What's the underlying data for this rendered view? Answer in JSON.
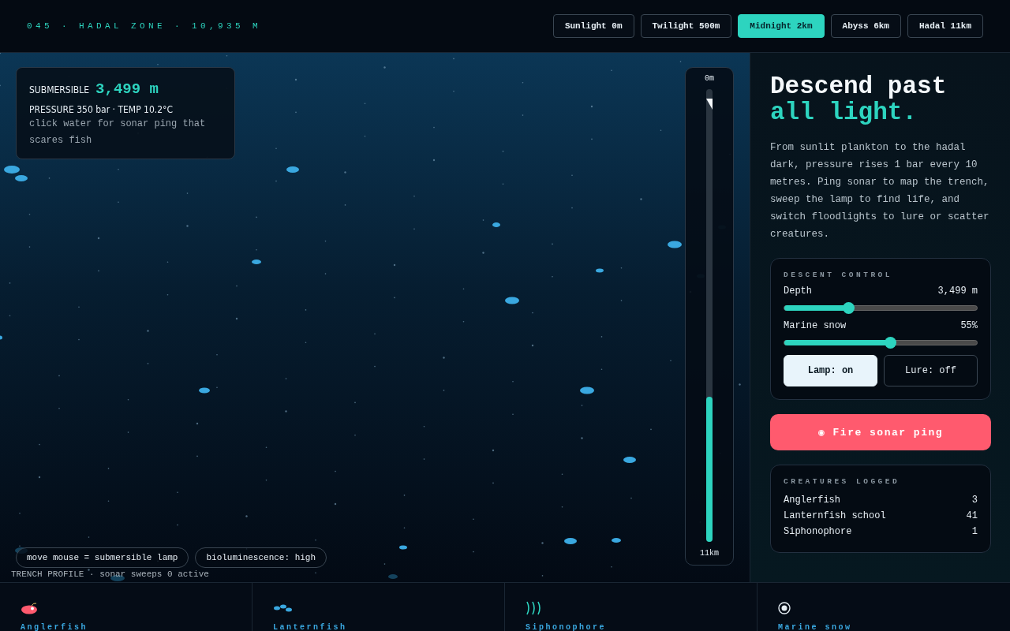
{
  "header": {
    "title": "045 · HADAL ZONE · 10,935 M"
  },
  "zones": [
    {
      "label": "Sunlight 0m",
      "selected": false
    },
    {
      "label": "Twilight 500m",
      "selected": false
    },
    {
      "label": "Midnight 2km",
      "selected": true
    },
    {
      "label": "Abyss 6km",
      "selected": false
    },
    {
      "label": "Hadal 11km",
      "selected": false
    }
  ],
  "hud": {
    "label": "SUBMERSIBLE",
    "depth": "3,499 m",
    "readings": "PRESSURE 350 bar · TEMP 10.2°C",
    "hint": "click water for sonar ping that scares fish"
  },
  "gauge": {
    "top": "0m",
    "bottom": "11km",
    "level": 0.32
  },
  "chips": [
    "move mouse = submersible lamp",
    "bioluminescence: high"
  ],
  "profile": "TRENCH PROFILE · sonar sweeps 0 active",
  "intro": {
    "title": "Descend past",
    "accent": "all light.",
    "body": "From sunlit plankton to the hadal dark, pressure rises 1 bar every 10 metres. Ping sonar to map the trench, sweep the lamp to find life, and switch floodlights to lure or scatter creatures."
  },
  "control": {
    "heading": "DESCENT CONTROL",
    "sliders": [
      {
        "label": "Depth",
        "reading": "3,499 m",
        "level": 0.33
      },
      {
        "label": "Marine snow",
        "reading": "55%",
        "level": 0.55
      }
    ],
    "toggles": [
      {
        "label": "Lamp: on",
        "on": true
      },
      {
        "label": "Lure: off",
        "on": false
      }
    ]
  },
  "ping_button": "◉ Fire sonar ping",
  "log": {
    "heading": "CREATURES LOGGED",
    "rows": [
      {
        "name": "Anglerfish",
        "count": "3"
      },
      {
        "name": "Lanternfish school",
        "count": "41"
      },
      {
        "name": "Siphonophore",
        "count": "1"
      }
    ]
  },
  "legend": [
    {
      "kind": "angler",
      "label": "Anglerfish"
    },
    {
      "kind": "lantern",
      "label": "Lanternfish"
    },
    {
      "kind": "siphon",
      "label": "Siphonophore"
    },
    {
      "kind": "snow",
      "label": "Marine snow"
    }
  ]
}
